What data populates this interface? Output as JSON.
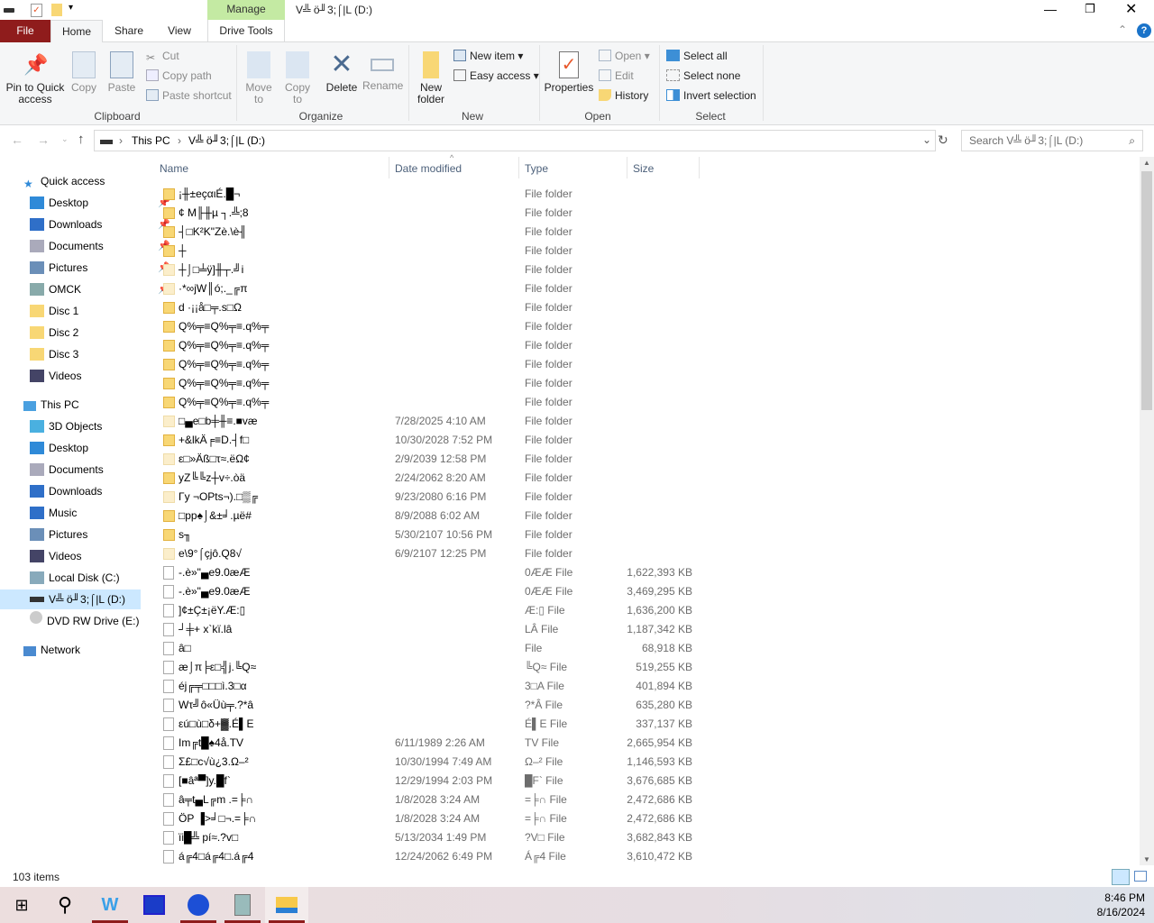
{
  "window": {
    "title": "V╩ ö╜3;⌠|L (D:)",
    "manage_tab": "Manage"
  },
  "tabs": {
    "file": "File",
    "home": "Home",
    "share": "Share",
    "view": "View",
    "drive_tools": "Drive Tools"
  },
  "ribbon": {
    "clipboard": {
      "label": "Clipboard",
      "pin": "Pin to Quick access",
      "copy": "Copy",
      "paste": "Paste",
      "cut": "Cut",
      "copy_path": "Copy path",
      "paste_shortcut": "Paste shortcut"
    },
    "organize": {
      "label": "Organize",
      "move_to": "Move to",
      "copy_to": "Copy to",
      "delete": "Delete",
      "rename": "Rename"
    },
    "new": {
      "label": "New",
      "new_folder": "New folder",
      "new_item": "New item",
      "easy_access": "Easy access"
    },
    "open": {
      "label": "Open",
      "properties": "Properties",
      "open": "Open",
      "edit": "Edit",
      "history": "History"
    },
    "select": {
      "label": "Select",
      "select_all": "Select all",
      "select_none": "Select none",
      "invert": "Invert selection"
    }
  },
  "address": {
    "crumbs": [
      "This PC",
      "V╩ ö╜3;⌠|L (D:)"
    ],
    "search_placeholder": "Search V╩ ö╜3;⌠|L (D:)"
  },
  "nav": {
    "quick_access": "Quick access",
    "quick_items": [
      "Desktop",
      "Downloads",
      "Documents",
      "Pictures",
      "OMCK",
      "Disc 1",
      "Disc 2",
      "Disc 3",
      "Videos"
    ],
    "this_pc": "This PC",
    "pc_items": [
      "3D Objects",
      "Desktop",
      "Documents",
      "Downloads",
      "Music",
      "Pictures",
      "Videos",
      "Local Disk (C:)",
      "V╩ ö╜3;⌠|L (D:)",
      "DVD RW Drive (E:)"
    ],
    "network": "Network"
  },
  "columns": {
    "name": "Name",
    "date": "Date modified",
    "type": "Type",
    "size": "Size"
  },
  "files": [
    {
      "name": "¡╫±eçαιÉ.█¬",
      "date": "",
      "type": "File folder",
      "size": "",
      "kind": "folder"
    },
    {
      "name": "¢ M╟╫µ ┐.╩;8",
      "date": "",
      "type": "File folder",
      "size": "",
      "kind": "folder"
    },
    {
      "name": "┤□K²K\"Zè.\\è╢",
      "date": "",
      "type": "File folder",
      "size": "",
      "kind": "folder"
    },
    {
      "name": "┼",
      "date": "",
      "type": "File folder",
      "size": "",
      "kind": "folder"
    },
    {
      "name": "┼⌡□╧ÿ]╫┬.╝i",
      "date": "",
      "type": "File folder",
      "size": "",
      "kind": "hidden"
    },
    {
      "name": "·*∞jW║ó;._╔π",
      "date": "",
      "type": "File folder",
      "size": "",
      "kind": "hidden"
    },
    {
      "name": "d ·¡¡å□╤.s□Ω",
      "date": "",
      "type": "File folder",
      "size": "",
      "kind": "folder"
    },
    {
      "name": "Q%╤≡Q%╤≡.q%╤",
      "date": "",
      "type": "File folder",
      "size": "",
      "kind": "folder"
    },
    {
      "name": "Q%╤≡Q%╤≡.q%╤",
      "date": "",
      "type": "File folder",
      "size": "",
      "kind": "folder"
    },
    {
      "name": "Q%╤≡Q%╤≡.q%╤",
      "date": "",
      "type": "File folder",
      "size": "",
      "kind": "folder"
    },
    {
      "name": "Q%╤≡Q%╤≡.q%╤",
      "date": "",
      "type": "File folder",
      "size": "",
      "kind": "folder"
    },
    {
      "name": "Q%╤≡Q%╤≡.q%╤",
      "date": "",
      "type": "File folder",
      "size": "",
      "kind": "folder"
    },
    {
      "name": "□▄e□b╪╫≡.■væ",
      "date": "7/28/2025 4:10 AM",
      "type": "File folder",
      "size": "",
      "kind": "hidden"
    },
    {
      "name": "+&lkÄ╒≡D.┤f□",
      "date": "10/30/2028 7:52 PM",
      "type": "File folder",
      "size": "",
      "kind": "folder"
    },
    {
      "name": "ε□»Äß□τ≈.ëΩ¢",
      "date": "2/9/2039 12:58 PM",
      "type": "File folder",
      "size": "",
      "kind": "hidden"
    },
    {
      "name": "yZ╚╚z┼v÷.òä",
      "date": "2/24/2062 8:20 AM",
      "type": "File folder",
      "size": "",
      "kind": "folder"
    },
    {
      "name": "Γy ¬OPts¬).□▒╔",
      "date": "9/23/2080 6:16 PM",
      "type": "File folder",
      "size": "",
      "kind": "hidden"
    },
    {
      "name": "□pp♠⌡&±╛.µë#",
      "date": "8/9/2088 6:02 AM",
      "type": "File folder",
      "size": "",
      "kind": "folder"
    },
    {
      "name": "s╖",
      "date": "5/30/2107 10:56 PM",
      "type": "File folder",
      "size": "",
      "kind": "folder"
    },
    {
      "name": "e\\9°⌠çjô.Q8√",
      "date": "6/9/2107 12:25 PM",
      "type": "File folder",
      "size": "",
      "kind": "hidden"
    },
    {
      "name": "-.è»\"▄e9.0æÆ",
      "date": "",
      "type": "0ÆÆ File",
      "size": "1,622,393 KB",
      "kind": "file"
    },
    {
      "name": "-.è»\"▄e9.0æÆ",
      "date": "",
      "type": "0ÆÆ File",
      "size": "3,469,295 KB",
      "kind": "file"
    },
    {
      "name": "]¢±Ç±¡ëY.Æ:▯",
      "date": "",
      "type": "Æ:▯ File",
      "size": "1,636,200 KB",
      "kind": "file"
    },
    {
      "name": "┘╪+ x`kï.lâ",
      "date": "",
      "type": "LÂ File",
      "size": "1,187,342 KB",
      "kind": "file"
    },
    {
      "name": "â□",
      "date": "",
      "type": "File",
      "size": "68,918 KB",
      "kind": "file"
    },
    {
      "name": "æ⌡π╞ε□╣j.╚Q≈",
      "date": "",
      "type": "╚Q≈ File",
      "size": "519,255 KB",
      "kind": "file"
    },
    {
      "name": "éj╔╤□□□ì.3□α",
      "date": "",
      "type": "3□A File",
      "size": "401,894 KB",
      "kind": "file"
    },
    {
      "name": "Wτ╝ô«Üù╤.?*â",
      "date": "",
      "type": "?*Â File",
      "size": "635,280 KB",
      "kind": "file"
    },
    {
      "name": "εú□ù□δ+▓.É▌E",
      "date": "",
      "type": "É▌E File",
      "size": "337,137 KB",
      "kind": "file"
    },
    {
      "name": "Im╔t█♠4å.TV",
      "date": "6/11/1989 2:26 AM",
      "type": "TV File",
      "size": "2,665,954 KB",
      "kind": "file"
    },
    {
      "name": "Σ£□c√ù¿3.Ω–²",
      "date": "10/30/1994 7:49 AM",
      "type": "Ω–² File",
      "size": "1,146,593 KB",
      "kind": "file"
    },
    {
      "name": "[■âª▀]y.█f`",
      "date": "12/29/1994 2:03 PM",
      "type": "█F` File",
      "size": "3,676,685 KB",
      "kind": "file"
    },
    {
      "name": "â╤t▄L╔m .=╞∩",
      "date": "1/8/2028 3:24 AM",
      "type": "=╞∩ File",
      "size": "2,472,686 KB",
      "kind": "file"
    },
    {
      "name": "ÖP ▐>╛□¬.=╞∩",
      "date": "1/8/2028 3:24 AM",
      "type": "=╞∩ File",
      "size": "2,472,686 KB",
      "kind": "file"
    },
    {
      "name": "ïi█╩ pí≈.?v□",
      "date": "5/13/2034 1:49 PM",
      "type": "?V□ File",
      "size": "3,682,843 KB",
      "kind": "file"
    },
    {
      "name": "á╔4□á╔4□.á╔4",
      "date": "12/24/2062 6:49 PM",
      "type": "Á╔4 File",
      "size": "3,610,472 KB",
      "kind": "file"
    }
  ],
  "status": {
    "count": "103 items"
  },
  "clock": {
    "time": "8:46 PM",
    "date": "8/16/2024"
  },
  "colors": {
    "file_tab": "#8f1c1c",
    "manage": "#c4eaa3",
    "selection": "#cce8ff",
    "accent": "#0078d7"
  }
}
